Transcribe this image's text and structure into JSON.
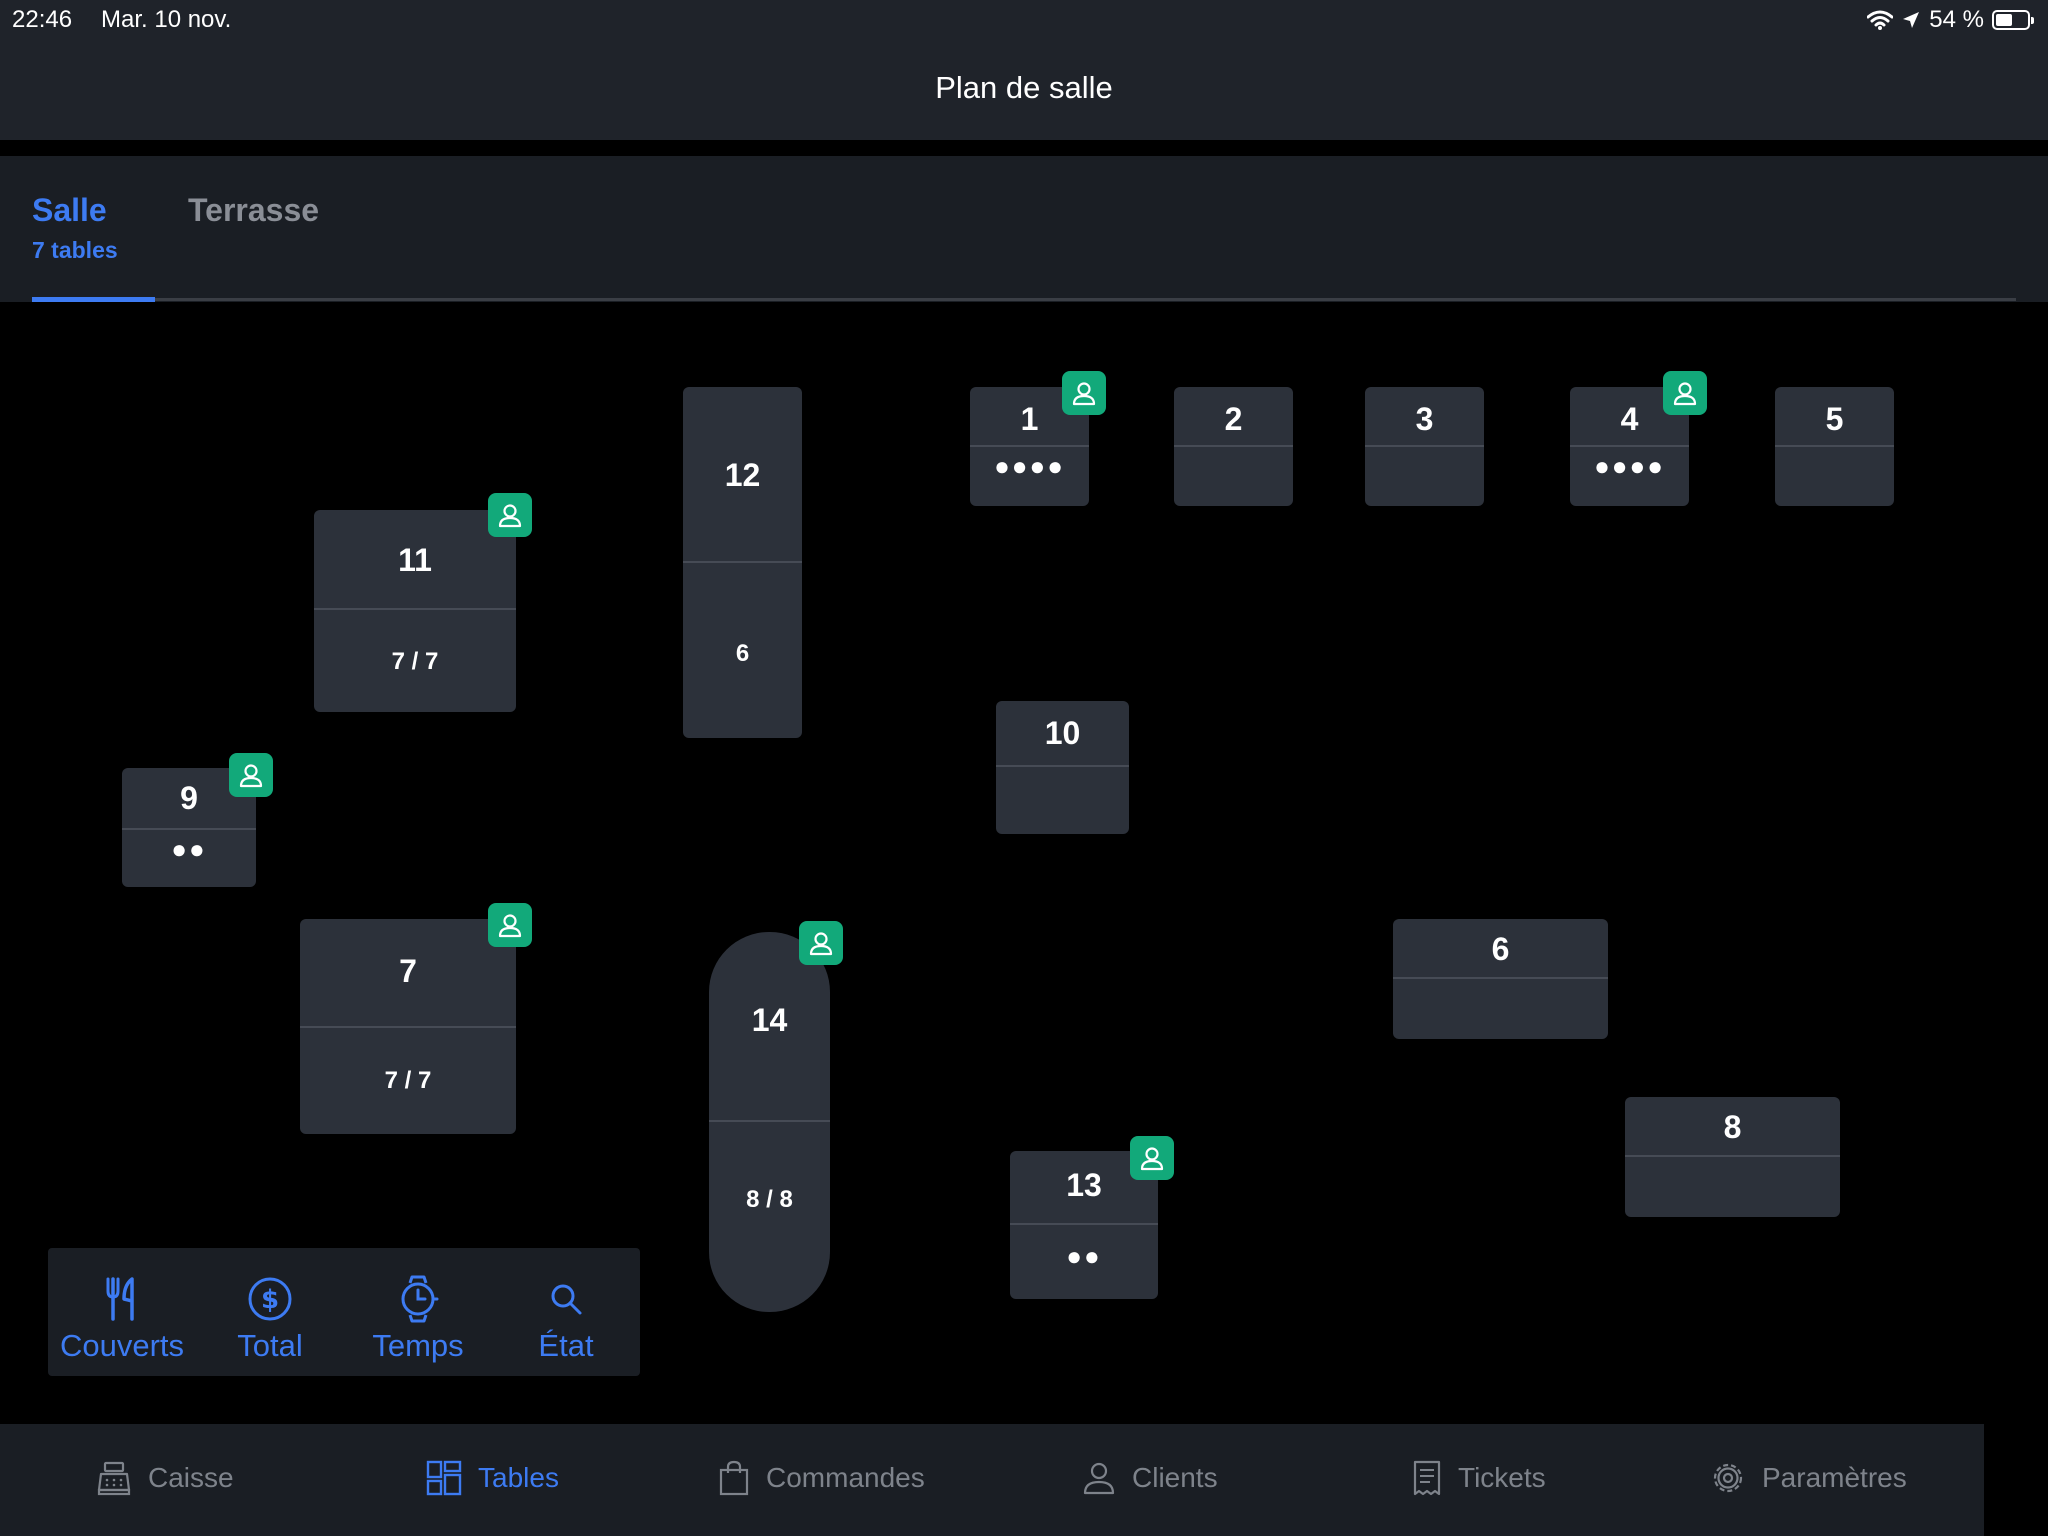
{
  "status": {
    "time": "22:46",
    "date": "Mar. 10 nov.",
    "battery": "54 %"
  },
  "header": {
    "title": "Plan de salle"
  },
  "tabs": [
    {
      "label": "Salle",
      "sub": "7 tables",
      "active": true
    },
    {
      "label": "Terrasse",
      "active": false
    }
  ],
  "tables": {
    "t1": {
      "num": "1",
      "info": "●●●●"
    },
    "t2": {
      "num": "2",
      "info": ""
    },
    "t3": {
      "num": "3",
      "info": ""
    },
    "t4": {
      "num": "4",
      "info": "●●●●"
    },
    "t5": {
      "num": "5",
      "info": ""
    },
    "t6": {
      "num": "6",
      "info": ""
    },
    "t7": {
      "num": "7",
      "info": "7 / 7"
    },
    "t8": {
      "num": "8",
      "info": ""
    },
    "t9": {
      "num": "9",
      "info": "●●"
    },
    "t10": {
      "num": "10",
      "info": ""
    },
    "t11": {
      "num": "11",
      "info": "7 / 7"
    },
    "t12": {
      "num": "12",
      "info": "6"
    },
    "t13": {
      "num": "13",
      "info": "●●"
    },
    "t14": {
      "num": "14",
      "info": "8 / 8"
    }
  },
  "metrics": {
    "couverts": "Couverts",
    "total": "Total",
    "temps": "Temps",
    "etat": "État"
  },
  "bottom_nav": {
    "caisse": "Caisse",
    "tables": "Tables",
    "commandes": "Commandes",
    "clients": "Clients",
    "tickets": "Tickets",
    "parametres": "Paramètres"
  },
  "colors": {
    "accent": "#3d7bf2",
    "occupied_badge": "#12a97a",
    "table_bg": "#2c313a"
  }
}
